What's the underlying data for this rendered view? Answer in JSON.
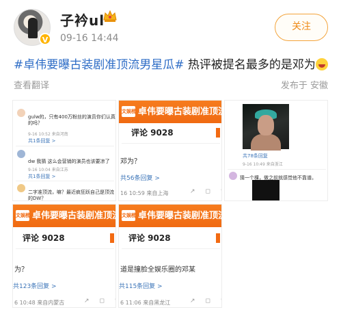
{
  "header": {
    "username": "子衿ul",
    "verified_badge": "V",
    "timestamp": "09-16 14:44",
    "follow_label": "关注"
  },
  "post": {
    "hashtag": "#卓伟要曝古装剧准顶流男星瓜#",
    "text": " 热评被提名最多的是邓为"
  },
  "meta": {
    "translate": "查看翻译",
    "source": "发布于 安徽"
  },
  "cards": {
    "c1": {
      "comment1": "gulw的，只有400万粉丝的演员你们认真的吗？",
      "comment1_reply": "共1条回复 >",
      "comment2": "dw 我猜 这么会营销的演员也该要凉了",
      "comment2_reply": "共1条回复 >",
      "comment3": "二字准顶流，嘛？最近疯狂跃自己是顶流的DW？",
      "comment3_reply": "共1条回复 >",
      "meta1": "9-16 10:52  来自河南",
      "meta2": "9-16 10:04  来自江苏",
      "meta3": "9-16 09:52  来自广东"
    },
    "c2": {
      "banner": "卓伟要曝古装剧准顶流男星瓜",
      "brand": "文娱榜",
      "count": "评论 9028",
      "snippet": "邓为？",
      "reply": "共56条回复 >",
      "meta": "16 10:59 来自上海"
    },
    "c3": {
      "reply": "共78条回复",
      "meta": "9-16 10:49  来自浙江",
      "comment": "猜一个棵，做之前就感觉他不靠谱。",
      "comment_meta": "9-16 10:39  来自北京"
    },
    "c4": {
      "banner": "卓伟要曝古装剧准顶流男星瓜",
      "brand": "文娱榜",
      "count": "评论 9028",
      "snippet": "为？",
      "reply": "共123条回复 >",
      "meta": "6 10:48  来自内蒙古"
    },
    "c5": {
      "banner": "卓伟要曝古装剧准顶流男星瓜",
      "brand": "文娱榜",
      "count": "评论 9028",
      "snippet": "道是撞脸全娱乐圈的邓某",
      "reply": "共115条回复 >",
      "meta": "6 11:06  来自黑龙江"
    }
  },
  "colors": {
    "accent_orange": "#f06a12",
    "link_blue": "#2d6cc6",
    "follow_orange": "#ef8a17"
  }
}
